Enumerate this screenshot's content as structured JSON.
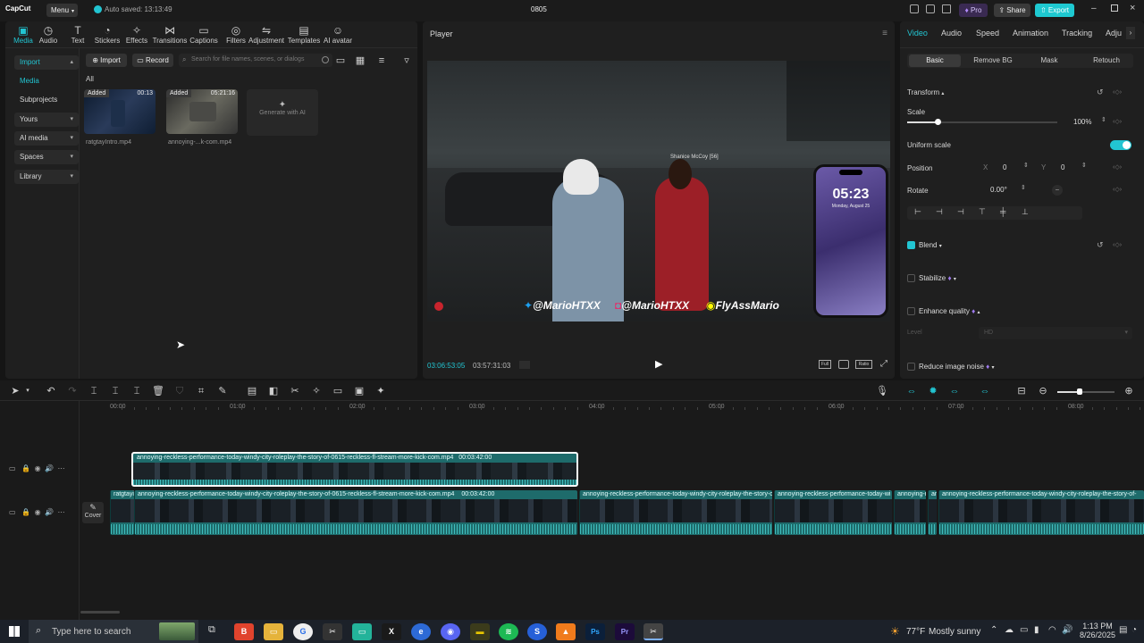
{
  "titlebar": {
    "app_name": "CapCut",
    "menu_label": "Menu",
    "autosave_text": "Auto saved: 13:13:49",
    "project_title": "0805",
    "pro_label": "Pro",
    "share_label": "Share",
    "export_label": "Export"
  },
  "toolbar": {
    "items": [
      {
        "label": "Media",
        "icon": "media-icon"
      },
      {
        "label": "Audio",
        "icon": "audio-icon"
      },
      {
        "label": "Text",
        "icon": "text-icon"
      },
      {
        "label": "Stickers",
        "icon": "stickers-icon"
      },
      {
        "label": "Effects",
        "icon": "effects-icon"
      },
      {
        "label": "Transitions",
        "icon": "transitions-icon"
      },
      {
        "label": "Captions",
        "icon": "captions-icon"
      },
      {
        "label": "Filters",
        "icon": "filters-icon"
      },
      {
        "label": "Adjustment",
        "icon": "adjustment-icon"
      },
      {
        "label": "Templates",
        "icon": "templates-icon"
      },
      {
        "label": "AI avatar",
        "icon": "ai-avatar-icon"
      }
    ]
  },
  "sidebar": {
    "items": [
      {
        "label": "Import"
      },
      {
        "label": "Media"
      },
      {
        "label": "Subprojects"
      },
      {
        "label": "Yours"
      },
      {
        "label": "AI media"
      },
      {
        "label": "Spaces"
      },
      {
        "label": "Library"
      }
    ]
  },
  "media": {
    "import_label": "Import",
    "record_label": "Record",
    "search_placeholder": "Search for file names, scenes, or dialogs",
    "filter_all": "All",
    "clips": [
      {
        "badge": "Added",
        "duration": "00:13",
        "name": "ratgtayIntro.mp4"
      },
      {
        "badge": "Added",
        "duration": "05:21:16",
        "name": "annoying-...k-com.mp4"
      }
    ],
    "generate_label": "Generate with AI"
  },
  "player": {
    "title": "Player",
    "current_time": "03:06:53:05",
    "total_time": "03:57:31:03",
    "full_label": "Full",
    "ratio_label": "Ratio",
    "overlay": {
      "name_tag": "Shanice McCoy [56]",
      "phone_time": "05:23",
      "phone_date": "Monday, August 25",
      "social1": "@MarioHTXX",
      "social2": "@MarioHTXX",
      "social3": "FlyAssMario"
    }
  },
  "inspector": {
    "tabs": [
      "Video",
      "Audio",
      "Speed",
      "Animation",
      "Tracking",
      "Adju"
    ],
    "subtabs": [
      "Basic",
      "Remove BG",
      "Mask",
      "Retouch"
    ],
    "transform_label": "Transform",
    "scale_label": "Scale",
    "scale_value": "100%",
    "scale_fraction": 0.2,
    "uniform_label": "Uniform scale",
    "position_label": "Position",
    "pos_x_label": "X",
    "pos_x": "0",
    "pos_y_label": "Y",
    "pos_y": "0",
    "rotate_label": "Rotate",
    "rotate_value": "0.00°",
    "blend_label": "Blend",
    "stabilize_label": "Stabilize",
    "enhance_label": "Enhance quality",
    "level_label": "Level",
    "level_value": "HD",
    "noise_label": "Reduce image noise"
  },
  "timeline": {
    "ruler": [
      "00:00",
      "01:00",
      "02:00",
      "03:00",
      "04:00",
      "05:00",
      "06:00",
      "07:00",
      "08:00"
    ],
    "track1_clip_title": "annoying-reckless-performance-today-windy-city-roleplay-the-story-of-0615-reckless-fl-stream-more-kick-com.mp4",
    "track1_clip_dur": "00:03:42:00",
    "track2_clips": [
      {
        "title": "ratgtayi"
      },
      {
        "title": "annoying-reckless-performance-today-windy-city-roleplay-the-story-of-0615-reckless-fl-stream-more-kick-com.mp4",
        "dur": "00:03:42:00"
      },
      {
        "title": "annoying-reckless-performance-today-windy-city-roleplay-the-story-o"
      },
      {
        "title": "annoying-reckless-performance-today-wi"
      },
      {
        "title": "annoying-re"
      },
      {
        "title": "an"
      },
      {
        "title": "annoying-reckless-performance-today-windy-city-roleplay-the-story-of-"
      }
    ],
    "cover_label": "Cover"
  },
  "taskbar": {
    "search_placeholder": "Type here to search",
    "weather_temp": "77°F",
    "weather_desc": "Mostly sunny",
    "time": "1:13 PM",
    "date": "8/26/2025"
  },
  "colors": {
    "accent": "#22c5d2",
    "clip": "#1e6b6b",
    "export": "#1ec9d1"
  }
}
